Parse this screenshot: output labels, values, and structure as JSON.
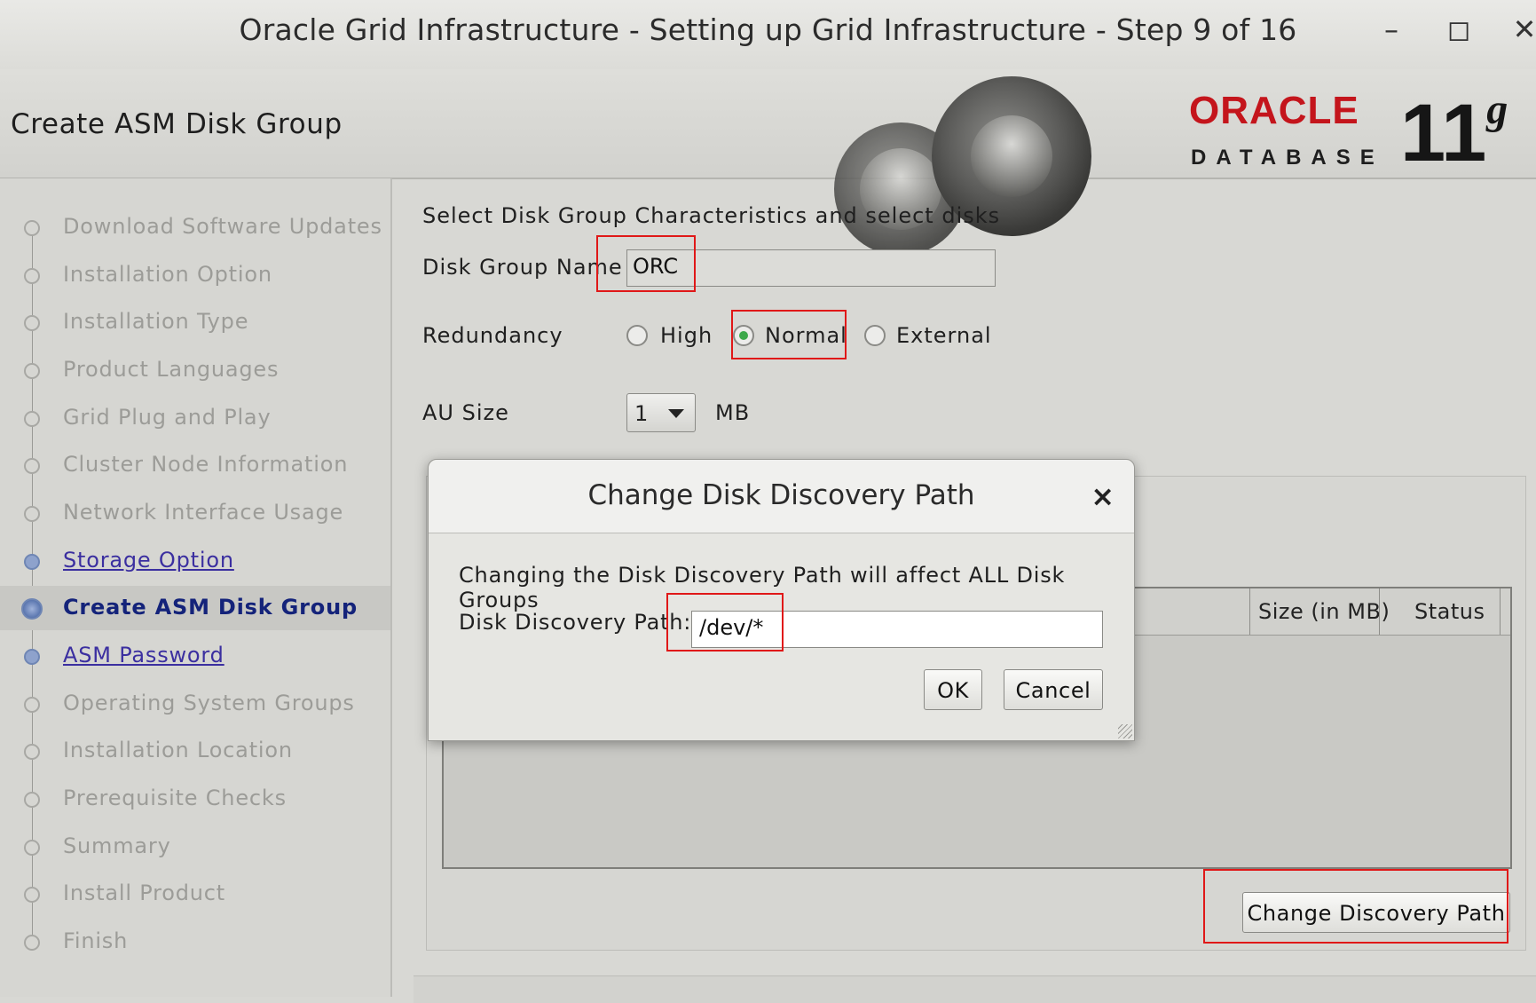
{
  "window": {
    "title": "Oracle Grid Infrastructure - Setting up Grid Infrastructure - Step 9 of 16",
    "minimize": "–",
    "maximize": "◻",
    "close": "✕"
  },
  "header": {
    "page_title": "Create ASM Disk Group",
    "brand": "ORACLE",
    "brand_sub": "DATABASE",
    "version": "11",
    "version_sup": "g",
    "brand_color": "#c4151c"
  },
  "sidebar": {
    "steps": [
      {
        "label": "Download Software Updates",
        "state": "pending"
      },
      {
        "label": "Installation Option",
        "state": "pending"
      },
      {
        "label": "Installation Type",
        "state": "pending"
      },
      {
        "label": "Product Languages",
        "state": "pending"
      },
      {
        "label": "Grid Plug and Play",
        "state": "pending"
      },
      {
        "label": "Cluster Node Information",
        "state": "pending"
      },
      {
        "label": "Network Interface Usage",
        "state": "pending"
      },
      {
        "label": "Storage Option",
        "state": "done"
      },
      {
        "label": "Create ASM Disk Group",
        "state": "current"
      },
      {
        "label": "ASM Password",
        "state": "done"
      },
      {
        "label": "Operating System Groups",
        "state": "pending"
      },
      {
        "label": "Installation Location",
        "state": "pending"
      },
      {
        "label": "Prerequisite Checks",
        "state": "pending"
      },
      {
        "label": "Summary",
        "state": "pending"
      },
      {
        "label": "Install Product",
        "state": "pending"
      },
      {
        "label": "Finish",
        "state": "pending"
      }
    ]
  },
  "main": {
    "instruction": "Select Disk Group Characteristics and select disks",
    "disk_group_name_label": "Disk Group Name",
    "disk_group_name_value": "ORC",
    "redundancy_label": "Redundancy",
    "redundancy_options": [
      {
        "label": "High",
        "selected": false
      },
      {
        "label": "Normal",
        "selected": true
      },
      {
        "label": "External",
        "selected": false
      }
    ],
    "au_size_label": "AU Size",
    "au_size_value": "1",
    "au_size_unit": "MB",
    "table_columns": [
      "Size (in MB)",
      "Status"
    ],
    "change_discovery_button": "Change Discovery Path"
  },
  "dialog": {
    "title": "Change Disk Discovery Path",
    "close": "×",
    "message": "Changing the Disk Discovery Path will affect ALL Disk Groups",
    "path_label": "Disk Discovery Path:",
    "path_value": "/dev/*",
    "ok_label": "OK",
    "cancel_label": "Cancel"
  },
  "highlight_color": "#e01818"
}
